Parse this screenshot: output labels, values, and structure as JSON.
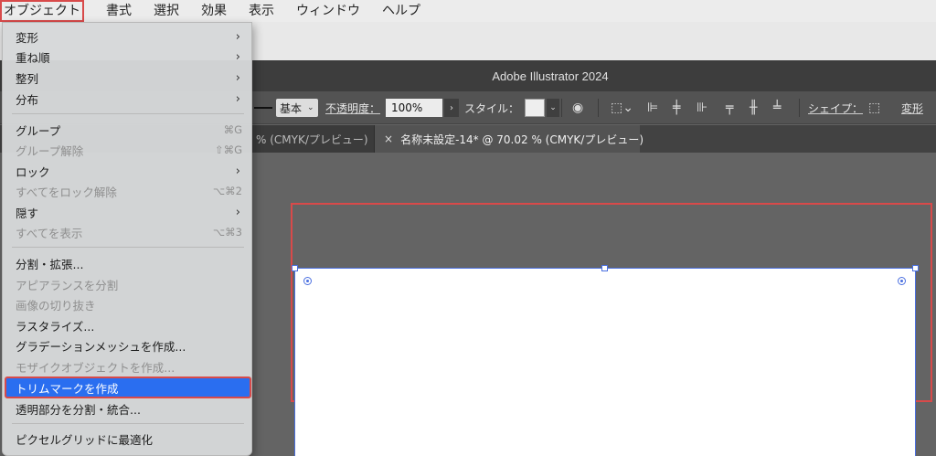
{
  "menubar": {
    "items": [
      "オブジェクト",
      "書式",
      "選択",
      "効果",
      "表示",
      "ウィンドウ",
      "ヘルプ"
    ]
  },
  "window": {
    "title": "Adobe Illustrator 2024"
  },
  "controlbar": {
    "stroke_style": "基本",
    "opacity_label": "不透明度：",
    "opacity_value": "100%",
    "style_label": "スタイル：",
    "shape_label": "シェイプ：",
    "transform_label": "変形"
  },
  "tabs": {
    "inactive": "% (CMYK/プレビュー)",
    "active_close": "×",
    "active": "名称未設定-14* @ 70.02 % (CMYK/プレビュー)"
  },
  "dropdown": {
    "items": [
      {
        "label": "変形",
        "type": "submenu"
      },
      {
        "label": "重ね順",
        "type": "submenu"
      },
      {
        "label": "整列",
        "type": "submenu"
      },
      {
        "label": "分布",
        "type": "submenu"
      },
      {
        "label": "グループ",
        "shortcut": "⌘G"
      },
      {
        "label": "グループ解除",
        "shortcut": "⇧⌘G",
        "disabled": true
      },
      {
        "label": "ロック",
        "type": "submenu"
      },
      {
        "label": "すべてをロック解除",
        "shortcut": "⌥⌘2",
        "disabled": true
      },
      {
        "label": "隠す",
        "type": "submenu"
      },
      {
        "label": "すべてを表示",
        "shortcut": "⌥⌘3",
        "disabled": true
      },
      {
        "label": "分割・拡張..."
      },
      {
        "label": "アピアランスを分割",
        "disabled": true
      },
      {
        "label": "画像の切り抜き",
        "disabled": true
      },
      {
        "label": "ラスタライズ..."
      },
      {
        "label": "グラデーションメッシュを作成..."
      },
      {
        "label": "モザイクオブジェクトを作成...",
        "disabled": true
      },
      {
        "label": "トリムマークを作成",
        "selected": true
      },
      {
        "label": "透明部分を分割・統合..."
      },
      {
        "label": "ピクセルグリッドに最適化"
      }
    ]
  },
  "colors": {
    "highlight": "#2a6ef0",
    "annotation_red": "#d84a4a",
    "artboard_selection": "#4a6fe0"
  },
  "icons": {
    "submenu": "chevron-right-icon"
  }
}
